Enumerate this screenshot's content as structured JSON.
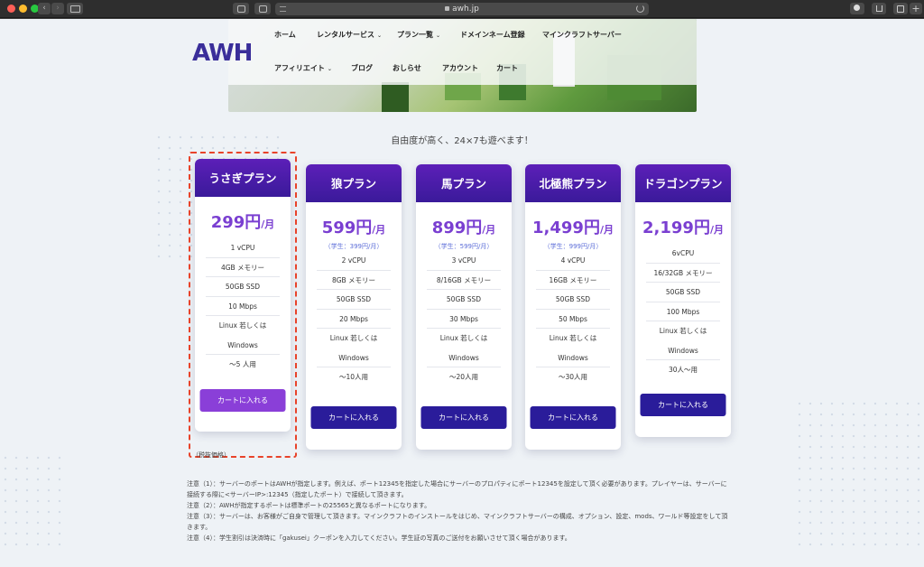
{
  "browser": {
    "url": "awh.jp",
    "nav_back": "‹",
    "nav_forward": "›",
    "new_tab": "+"
  },
  "header": {
    "logo": "AWH",
    "nav": [
      {
        "label": "ホーム",
        "dropdown": false
      },
      {
        "label": "レンタルサービス",
        "dropdown": true
      },
      {
        "label": "プラン一覧",
        "dropdown": true
      },
      {
        "label": "ドメインネーム登録",
        "dropdown": false
      },
      {
        "label": "マインクラフトサーバー",
        "dropdown": false
      },
      {
        "label": "アフィリエイト",
        "dropdown": true
      },
      {
        "label": "ブログ",
        "dropdown": false
      },
      {
        "label": "おしらせ",
        "dropdown": false
      },
      {
        "label": "アカウント",
        "dropdown": false
      },
      {
        "label": "カート",
        "dropdown": false
      }
    ],
    "caret": "⌄"
  },
  "tagline": "自由度が高く、24×7も遊べます！",
  "plans": [
    {
      "name": "うさぎプラン",
      "price": "299円",
      "unit": "/月",
      "student": "",
      "specs": [
        "1 vCPU",
        "4GB メモリー",
        "50GB SSD",
        "10 Mbps",
        "Linux 若しくは",
        "Windows",
        "〜5 人用"
      ],
      "cart": "カートに入れる",
      "highlighted": true
    },
    {
      "name": "狼プラン",
      "price": "599円",
      "unit": "/月",
      "student": "（学生：399円/月）",
      "specs": [
        "2 vCPU",
        "8GB メモリー",
        "50GB SSD",
        "20 Mbps",
        "Linux 若しくは",
        "Windows",
        "〜10人用"
      ],
      "cart": "カートに入れる",
      "highlighted": false
    },
    {
      "name": "馬プラン",
      "price": "899円",
      "unit": "/月",
      "student": "（学生：599円/月）",
      "specs": [
        "3 vCPU",
        "8/16GB メモリー",
        "50GB SSD",
        "30 Mbps",
        "Linux 若しくは",
        "Windows",
        "〜20人用"
      ],
      "cart": "カートに入れる",
      "highlighted": false
    },
    {
      "name": "北極熊プラン",
      "price": "1,499円",
      "unit": "/月",
      "student": "（学生：999円/月）",
      "specs": [
        "4 vCPU",
        "16GB メモリー",
        "50GB SSD",
        "50 Mbps",
        "Linux 若しくは",
        "Windows",
        "〜30人用"
      ],
      "cart": "カートに入れる",
      "highlighted": false
    },
    {
      "name": "ドラゴンプラン",
      "price": "2,199円",
      "unit": "/月",
      "student": "",
      "specs": [
        "6vCPU",
        "16/32GB メモリー",
        "50GB SSD",
        "100 Mbps",
        "Linux 若しくは",
        "Windows",
        "30人〜用"
      ],
      "cart": "カートに入れる",
      "highlighted": false
    }
  ],
  "tax_note": "（税抜価格）",
  "notes": [
    "注意（1）：サーバーのポートはAWHが指定します。例えば、ポート12345を指定した場合にサーバーのプロパティにポート12345を設定して頂く必要があります。プレイヤーは、サーバーに接続する際に<サーバーIP>:12345（指定したポート）で接続して頂きます。",
    "注意（2）：AWHが指定するポートは標準ポートの25565と異なるポートになります。",
    "注意（3）：サーバーは、お客様がご自身で管理して頂きます。マインクラフトのインストールをはじめ、マインクラフトサーバーの構成、オプション、設定、mods、ワールド等設定をして頂きます。",
    "注意（4）：学生割引は決済時に「gakusei」クーポンを入力してください。学生証の写真のご送付をお願いさせて頂く場合があります。"
  ],
  "colors": {
    "accent_purple": "#7a3fd1",
    "card_header": "#3a1a9a",
    "button_dark": "#2a1c9a",
    "button_light": "#8a3fd8",
    "highlight_border": "#e8432a",
    "student_text": "#5b6cd8"
  }
}
